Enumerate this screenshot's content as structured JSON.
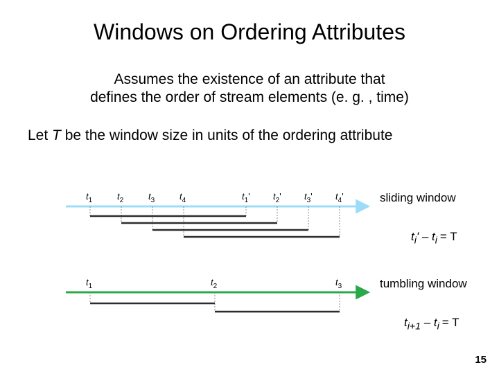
{
  "title": "Windows on Ordering Attributes",
  "subtitle_line1": "Assumes the existence of an attribute that",
  "subtitle_line2": "defines the order of stream elements (e. g. , time)",
  "body_prefix": "Let ",
  "body_T": "T",
  "body_suffix": " be the window size in units of the ordering attribute",
  "sliding": {
    "ticks": [
      {
        "base": "t",
        "sub": "1",
        "prime": ""
      },
      {
        "base": "t",
        "sub": "2",
        "prime": ""
      },
      {
        "base": "t",
        "sub": "3",
        "prime": ""
      },
      {
        "base": "t",
        "sub": "4",
        "prime": ""
      },
      {
        "base": "t",
        "sub": "1",
        "prime": "'"
      },
      {
        "base": "t",
        "sub": "2",
        "prime": "'"
      },
      {
        "base": "t",
        "sub": "3",
        "prime": "'"
      },
      {
        "base": "t",
        "sub": "4",
        "prime": "'"
      }
    ],
    "label": "sliding window",
    "formula_prefix": "t",
    "formula_sub1": "i",
    "formula_prime": "'",
    "formula_mid": " – t",
    "formula_sub2": "i ",
    "formula_eq": "= T"
  },
  "tumbling": {
    "ticks": [
      {
        "base": "t",
        "sub": "1"
      },
      {
        "base": "t",
        "sub": "2"
      },
      {
        "base": "t",
        "sub": "3"
      }
    ],
    "label": "tumbling window",
    "formula_prefix": "t",
    "formula_sub1": "i+1",
    "formula_mid": " – t",
    "formula_sub2": "i ",
    "formula_eq": "= T"
  },
  "page_number": "15",
  "colors": {
    "axis": "#9ddcf9",
    "arrow_green": "#2aa84a",
    "window_bar": "#2b2b2b",
    "dash": "#888888"
  }
}
